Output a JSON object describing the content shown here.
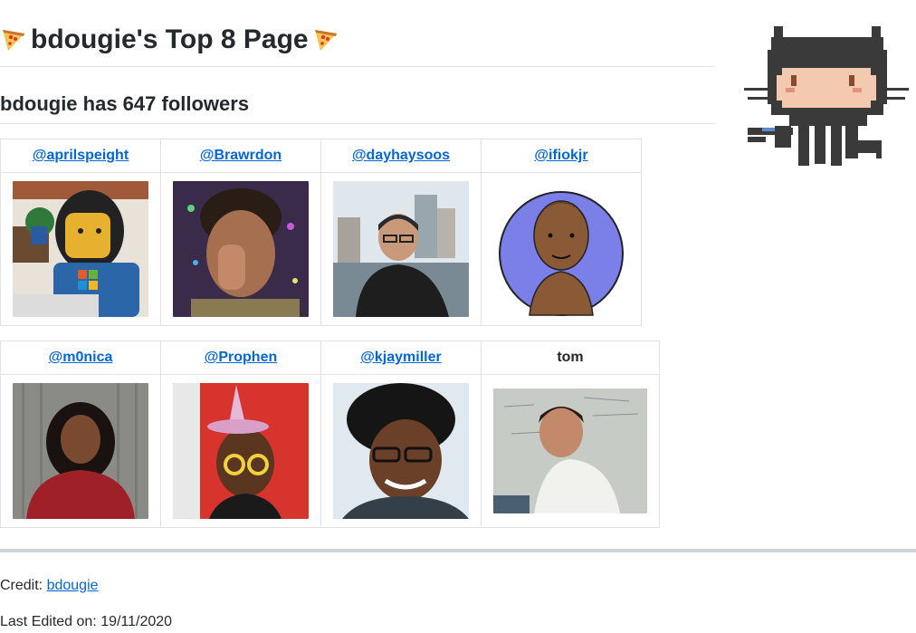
{
  "header": {
    "title": "bdougie's Top 8 Page",
    "followers_line": "bdougie has 647 followers"
  },
  "icons": {
    "title_left": "pizza-icon",
    "title_right": "pizza-icon",
    "corner": "octocat-icon"
  },
  "grid": {
    "row1": [
      {
        "handle": "@aprilspeight",
        "is_link": true,
        "avatar": "lego-figure-avatar"
      },
      {
        "handle": "@Brawrdon",
        "is_link": true,
        "avatar": "photo-avatar"
      },
      {
        "handle": "@dayhaysoos",
        "is_link": true,
        "avatar": "photo-avatar"
      },
      {
        "handle": "@ifiokjr",
        "is_link": true,
        "avatar": "illustrated-avatar"
      }
    ],
    "row2": [
      {
        "handle": "@m0nica",
        "is_link": true,
        "avatar": "photo-avatar"
      },
      {
        "handle": "@Prophen",
        "is_link": true,
        "avatar": "photo-avatar"
      },
      {
        "handle": "@kjaymiller",
        "is_link": true,
        "avatar": "photo-avatar"
      },
      {
        "handle": "tom",
        "is_link": false,
        "avatar": "photo-avatar"
      }
    ]
  },
  "footer": {
    "credit_label": "Credit: ",
    "credit_link": "bdougie",
    "last_edited": "Last Edited on: 19/11/2020"
  },
  "colors": {
    "link": "#0366d6",
    "text": "#24292e",
    "border": "#dfe2e5"
  }
}
